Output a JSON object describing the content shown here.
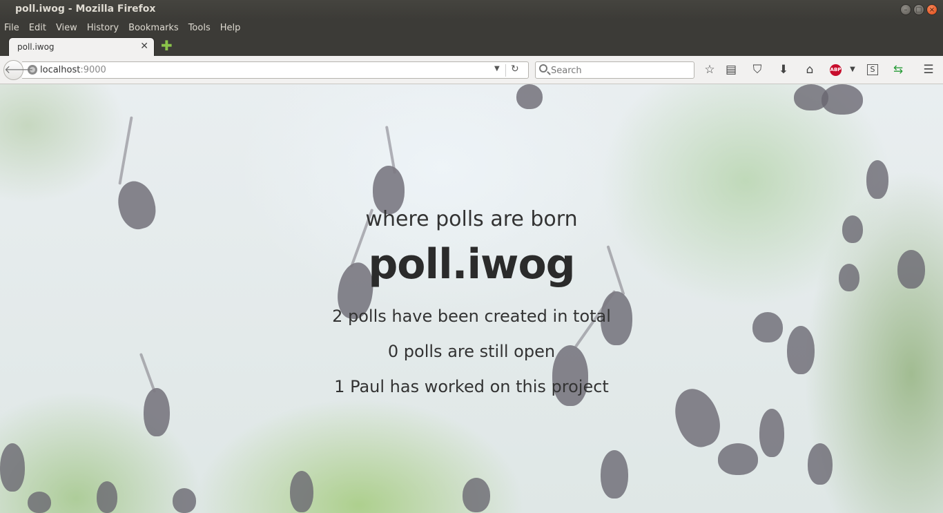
{
  "window": {
    "title": "poll.iwog - Mozilla Firefox"
  },
  "menu": {
    "items": [
      "File",
      "Edit",
      "View",
      "History",
      "Bookmarks",
      "Tools",
      "Help"
    ]
  },
  "tabs": [
    {
      "label": "poll.iwog"
    }
  ],
  "navbar": {
    "url_host": "localhost",
    "url_port": ":9000",
    "search_placeholder": "Search"
  },
  "toolbar_icons": [
    "bookmark-star-icon",
    "reading-list-icon",
    "pocket-icon",
    "downloads-icon",
    "home-icon",
    "adblock-plus-icon",
    "extension-s-icon",
    "sync-arrows-icon",
    "hamburger-menu-icon"
  ],
  "page": {
    "subtitle": "where polls are born",
    "brand": "poll.iwog",
    "stats": [
      "2 polls have been created in total",
      "0 polls are still open",
      "1 Paul has worked on this project"
    ]
  }
}
